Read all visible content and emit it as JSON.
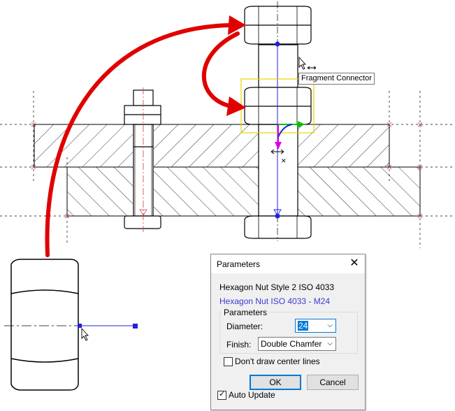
{
  "tooltip": {
    "text": "Fragment Connector"
  },
  "dialog": {
    "title": "Parameters",
    "standard_name": "Hexagon Nut Style 2 ISO 4033",
    "designation": "Hexagon Nut ISO 4033 - M24",
    "group_title": "Parameters",
    "diameter_label": "Diameter:",
    "diameter_value": "24",
    "finish_label": "Finish:",
    "finish_value": "Double Chamfer",
    "no_center_lines_label": "Don't draw center lines",
    "no_center_lines_checked": false,
    "ok_label": "OK",
    "cancel_label": "Cancel",
    "auto_update_label": "Auto Update",
    "auto_update_checked": true
  },
  "colors": {
    "arrow": "#e00000",
    "highlight": "#e8d400",
    "centerline": "#d04040",
    "connector": "#2020e0",
    "axis_green": "#00c000",
    "axis_magenta": "#e000e0",
    "link": "#3a3ad0"
  },
  "icons": [
    "move-cursor-icon",
    "pointer-cursor-icon",
    "close-icon",
    "dropdown-arrow-icon",
    "check-icon"
  ]
}
